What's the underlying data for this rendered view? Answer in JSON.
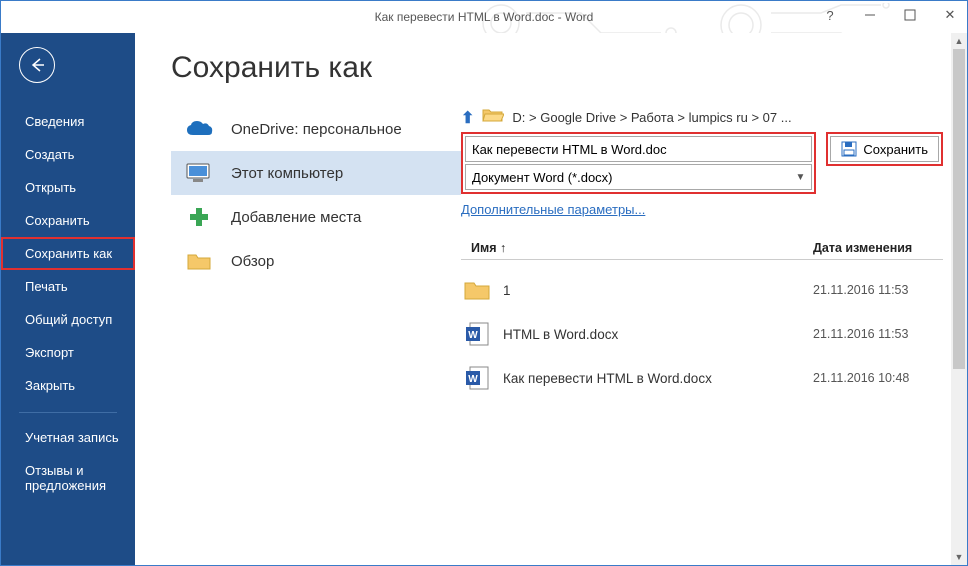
{
  "window": {
    "title": "Как перевести HTML в Word.doc - Word"
  },
  "sidebar": {
    "items": [
      {
        "label": "Сведения"
      },
      {
        "label": "Создать"
      },
      {
        "label": "Открыть"
      },
      {
        "label": "Сохранить"
      },
      {
        "label": "Сохранить как"
      },
      {
        "label": "Печать"
      },
      {
        "label": "Общий доступ"
      },
      {
        "label": "Экспорт"
      },
      {
        "label": "Закрыть"
      }
    ],
    "footer": [
      {
        "label": "Учетная запись"
      },
      {
        "label": "Отзывы и предложения"
      }
    ]
  },
  "page": {
    "title": "Сохранить как"
  },
  "locations": {
    "items": [
      {
        "label": "OneDrive: персональное"
      },
      {
        "label": "Этот компьютер"
      },
      {
        "label": "Добавление места"
      },
      {
        "label": "Обзор"
      }
    ]
  },
  "save": {
    "path": "D: > Google Drive > Работа > lumpics ru > 07 ...",
    "filename": "Как перевести HTML в Word.doc",
    "filetype": "Документ Word (*.docx)",
    "more_link": "Дополнительные параметры...",
    "button": "Сохранить"
  },
  "files": {
    "headers": {
      "name": "Имя ↑",
      "date": "Дата изменения"
    },
    "rows": [
      {
        "type": "folder",
        "name": "1",
        "date": "21.11.2016 11:53"
      },
      {
        "type": "docx",
        "name": "HTML в Word.docx",
        "date": "21.11.2016 11:53"
      },
      {
        "type": "docx",
        "name": "Как перевести HTML в Word.docx",
        "date": "21.11.2016 10:48"
      }
    ]
  }
}
